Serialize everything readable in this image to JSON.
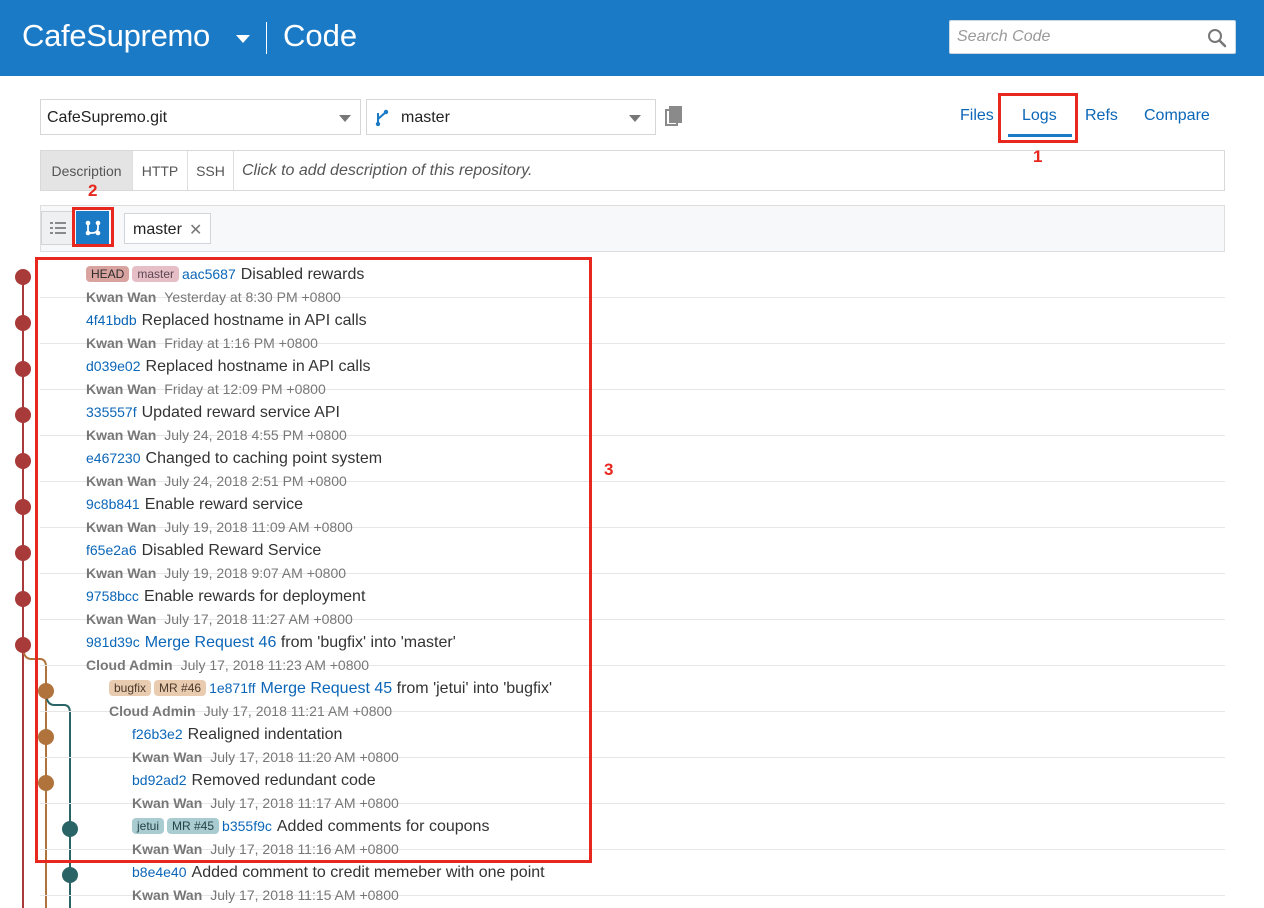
{
  "header": {
    "project_name": "CafeSupremo",
    "section_title": "Code",
    "search_placeholder": "Search Code"
  },
  "selectors": {
    "repository": "CafeSupremo.git",
    "branch": "master"
  },
  "nav_tabs": {
    "files": "Files",
    "logs": "Logs",
    "refs": "Refs",
    "compare": "Compare",
    "active": "Logs"
  },
  "description": {
    "tabs": [
      "Description",
      "HTTP",
      "SSH"
    ],
    "active_tab": "Description",
    "placeholder_text": "Click to add description of this repository."
  },
  "toolbar": {
    "active_view": "graph",
    "branch_filter": "master",
    "remove_symbol": "✕"
  },
  "annotations": [
    "1",
    "2",
    "3"
  ],
  "colors": {
    "header_bg": "#1b7ac6",
    "link": "#0b66b8",
    "master_branch": "#a83a3a",
    "bugfix_branch": "#b0733b",
    "jetui_branch": "#2b6466",
    "annotation": "#e8271f"
  },
  "commits": [
    {
      "badges": [
        {
          "text": "HEAD",
          "kind": "head"
        },
        {
          "text": "master",
          "kind": "master"
        }
      ],
      "hash": "aac5687",
      "message": "Disabled rewards",
      "author": "Kwan Wan",
      "date": "Yesterday at 8:30 PM +0800"
    },
    {
      "badges": [],
      "hash": "4f41bdb",
      "message": "Replaced hostname in API calls",
      "author": "Kwan Wan",
      "date": "Friday at 1:16 PM +0800"
    },
    {
      "badges": [],
      "hash": "d039e02",
      "message": "Replaced hostname in API calls",
      "author": "Kwan Wan",
      "date": "Friday at 12:09 PM +0800"
    },
    {
      "badges": [],
      "hash": "335557f",
      "message": "Updated reward service API",
      "author": "Kwan Wan",
      "date": "July 24, 2018 4:55 PM +0800"
    },
    {
      "badges": [],
      "hash": "e467230",
      "message": "Changed to caching point system",
      "author": "Kwan Wan",
      "date": "July 24, 2018 2:51 PM +0800"
    },
    {
      "badges": [],
      "hash": "9c8b841",
      "message": "Enable reward service",
      "author": "Kwan Wan",
      "date": "July 19, 2018 11:09 AM +0800"
    },
    {
      "badges": [],
      "hash": "f65e2a6",
      "message": "Disabled Reward Service",
      "author": "Kwan Wan",
      "date": "July 19, 2018 9:07 AM +0800"
    },
    {
      "badges": [],
      "hash": "9758bcc",
      "message": "Enable rewards for deployment",
      "author": "Kwan Wan",
      "date": "July 17, 2018 11:27 AM +0800"
    },
    {
      "badges": [],
      "hash": "981d39c",
      "mr_link": "Merge Request 46",
      "message": "from 'bugfix' into 'master'",
      "author": "Cloud Admin",
      "date": "July 17, 2018 11:23 AM +0800"
    },
    {
      "badges": [
        {
          "text": "bugfix",
          "kind": "bugfix"
        },
        {
          "text": "MR #46",
          "kind": "mr-bugfix"
        }
      ],
      "hash": "1e871ff",
      "mr_link": "Merge Request 45",
      "message": "from 'jetui' into 'bugfix'",
      "author": "Cloud Admin",
      "date": "July 17, 2018 11:21 AM +0800"
    },
    {
      "badges": [],
      "hash": "f26b3e2",
      "message": "Realigned indentation",
      "author": "Kwan Wan",
      "date": "July 17, 2018 11:20 AM +0800"
    },
    {
      "badges": [],
      "hash": "bd92ad2",
      "message": "Removed redundant code",
      "author": "Kwan Wan",
      "date": "July 17, 2018 11:17 AM +0800"
    },
    {
      "badges": [
        {
          "text": "jetui",
          "kind": "jetui"
        },
        {
          "text": "MR #45",
          "kind": "mr-jetui"
        }
      ],
      "hash": "b355f9c",
      "message": "Added comments for coupons",
      "author": "Kwan Wan",
      "date": "July 17, 2018 11:16 AM +0800"
    },
    {
      "badges": [],
      "hash": "b8e4e40",
      "message": "Added comment to credit memeber with one point",
      "author": "Kwan Wan",
      "date": "July 17, 2018 11:15 AM +0800"
    }
  ]
}
